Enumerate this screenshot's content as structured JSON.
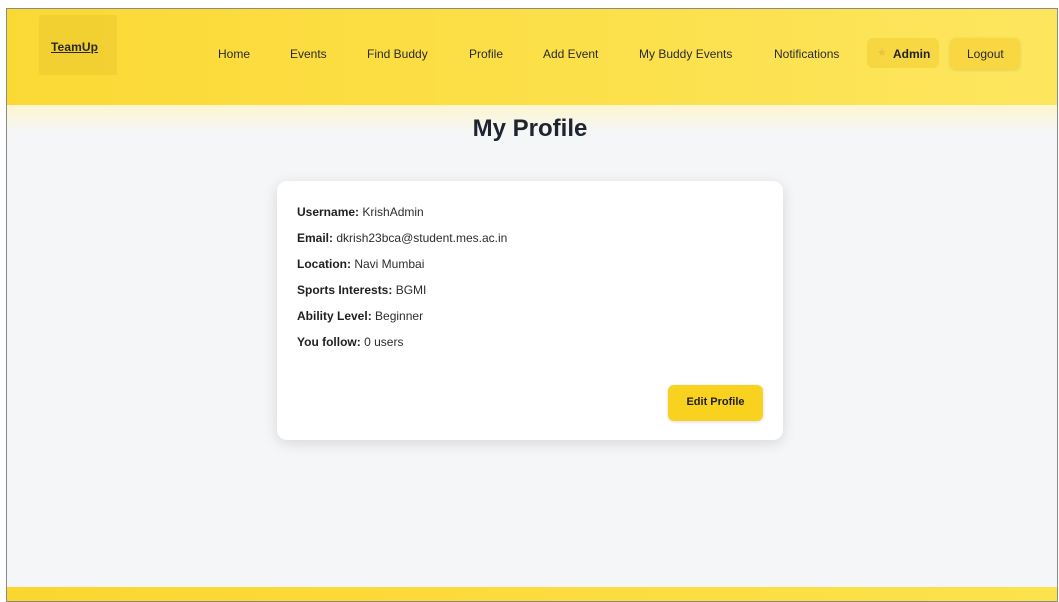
{
  "app": {
    "logo": "TeamUp"
  },
  "nav": {
    "links": [
      "Home",
      "Events",
      "Find Buddy",
      "Profile",
      "Add Event",
      "My Buddy Events",
      "Notifications"
    ],
    "admin_label": "Admin",
    "admin_icon": "star-icon",
    "logout_label": "Logout"
  },
  "page": {
    "title": "My Profile"
  },
  "profile": {
    "fields": [
      {
        "label": "Username:",
        "value": "KrishAdmin"
      },
      {
        "label": "Email:",
        "value": "dkrish23bca@student.mes.ac.in"
      },
      {
        "label": "Location:",
        "value": "Navi Mumbai"
      },
      {
        "label": "Sports Interests:",
        "value": "BGMI"
      },
      {
        "label": "Ability Level:",
        "value": "Beginner"
      },
      {
        "label": "You follow:",
        "value": "0 users"
      }
    ],
    "edit_label": "Edit Profile"
  },
  "colors": {
    "accent": "#f8d21f",
    "navbar": "#fbd935",
    "background": "#f5f6f8",
    "title": "#1e2430"
  }
}
